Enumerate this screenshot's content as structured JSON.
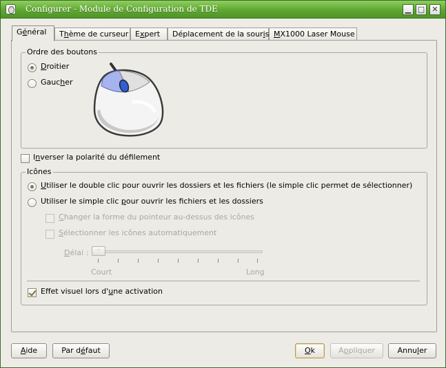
{
  "window": {
    "title": "Configurer - Module de Configuration de TDE",
    "min_glyph": "▁",
    "max_glyph": "□",
    "close_glyph": "✕"
  },
  "tabs": [
    {
      "pre": "G",
      "acc": "é",
      "post": "néral"
    },
    {
      "pre": "T",
      "acc": "h",
      "post": "ème de curseur"
    },
    {
      "pre": "E",
      "acc": "x",
      "post": "pert"
    },
    {
      "pre": "Déplacement de la sour",
      "acc": "i",
      "post": "s"
    },
    {
      "pre": "",
      "acc": "M",
      "post": "X1000 Laser Mouse"
    }
  ],
  "buttons_order": {
    "title": "Ordre des boutons",
    "right": {
      "pre": "",
      "acc": "D",
      "post": "roitier",
      "checked": true
    },
    "left": {
      "pre": "Gauc",
      "acc": "h",
      "post": "er",
      "checked": false
    }
  },
  "invert_scroll": {
    "pre": "I",
    "acc": "n",
    "post": "verser la polarité du défilement",
    "checked": false
  },
  "icons": {
    "title": "Icônes",
    "double_click": {
      "pre": "",
      "acc": "U",
      "post": "tiliser le double clic pour ouvrir les dossiers et les fichiers (le simple clic permet de sélectionner)",
      "checked": true
    },
    "single_click": {
      "pre": "Utiliser le simple clic ",
      "acc": "p",
      "post": "our ouvrir les fichiers et les dossiers",
      "checked": false
    },
    "change_pointer": {
      "pre": "",
      "acc": "C",
      "post": "hanger la forme du pointeur au-dessus des icônes"
    },
    "auto_select": {
      "pre": "",
      "acc": "S",
      "post": "électionner les icônes automatiquement"
    },
    "delay_label": {
      "pre": "",
      "acc": "D",
      "post": "élai :"
    },
    "slider_min": "Court",
    "slider_max": "Long",
    "visual_feedback": {
      "pre": "Effet visuel lors d'",
      "acc": "u",
      "post": "ne activation",
      "checked": true
    }
  },
  "footer": {
    "help": {
      "pre": "",
      "acc": "A",
      "post": "ide"
    },
    "defaults": {
      "pre": "Par d",
      "acc": "é",
      "post": "faut"
    },
    "ok": {
      "pre": "",
      "acc": "O",
      "post": "k"
    },
    "apply": {
      "pre": "A",
      "acc": "p",
      "post": "pliquer"
    },
    "cancel": {
      "pre": "Annu",
      "acc": "l",
      "post": "er"
    }
  }
}
